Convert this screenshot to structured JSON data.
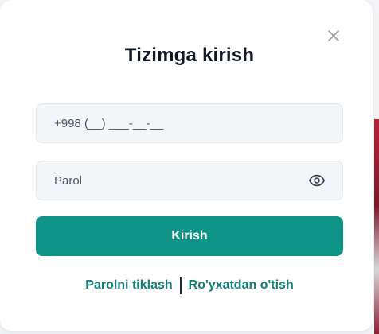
{
  "modal": {
    "title": "Tizimga kirish",
    "phone_placeholder": "+998 (__) ___-__-__",
    "password_placeholder": "Parol",
    "submit_label": "Kirish",
    "forgot_link": "Parolni tiklash",
    "register_link": "Ro'yxatdan o'tish",
    "close_icon": "close-icon",
    "eye_icon": "eye-icon"
  },
  "colors": {
    "accent": "#0f9488",
    "link": "#0f7f77",
    "field_bg": "#f3f6f9",
    "title": "#111827"
  }
}
